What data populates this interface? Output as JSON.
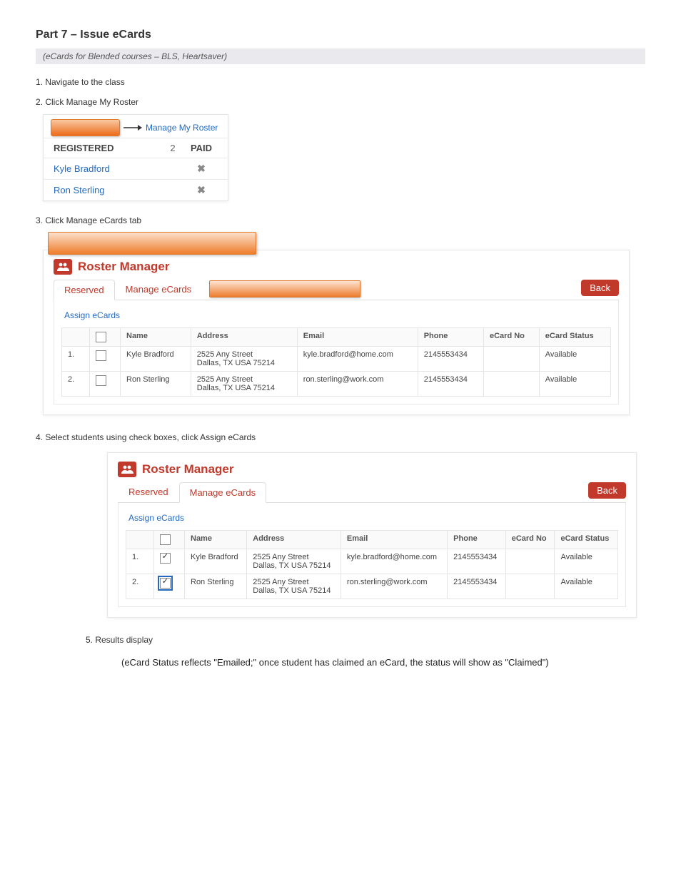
{
  "doc": {
    "title": "Part 7 – Issue eCards",
    "subtitle": "(eCards for Blended courses – BLS, Heartsaver)"
  },
  "steps": {
    "s1": "1. Navigate to the class",
    "s2": "2. Click Manage My Roster",
    "s3": "3. Click Manage eCards tab",
    "s4": "4. Select students using check boxes, click Assign eCards",
    "s5_intro": "5. Results display",
    "s5_note": "(eCard Status reflects \"Emailed;\" once student has claimed an eCard, the status will show as \"Claimed\")"
  },
  "fig1": {
    "link": "Manage My Roster",
    "head_left": "REGISTERED",
    "head_mid": "2",
    "head_right": "PAID",
    "rows": [
      {
        "name": "Kyle Bradford"
      },
      {
        "name": "Ron Sterling"
      }
    ]
  },
  "roster": {
    "title": "Roster Manager",
    "tab_reserved": "Reserved",
    "tab_manage": "Manage eCards",
    "back": "Back",
    "assign": "Assign eCards",
    "cols": {
      "name": "Name",
      "address": "Address",
      "email": "Email",
      "phone": "Phone",
      "ecard_no": "eCard No",
      "ecard_status": "eCard Status"
    },
    "rows": [
      {
        "idx": "1.",
        "name": "Kyle Bradford",
        "addr1": "2525 Any Street",
        "addr2": "Dallas, TX USA 75214",
        "email": "kyle.bradford@home.com",
        "phone": "2145553434",
        "ecard_no": "",
        "ecard_status": "Available"
      },
      {
        "idx": "2.",
        "name": "Ron Sterling",
        "addr1": "2525 Any Street",
        "addr2": "Dallas, TX USA 75214",
        "email": "ron.sterling@work.com",
        "phone": "2145553434",
        "ecard_no": "",
        "ecard_status": "Available"
      }
    ]
  }
}
